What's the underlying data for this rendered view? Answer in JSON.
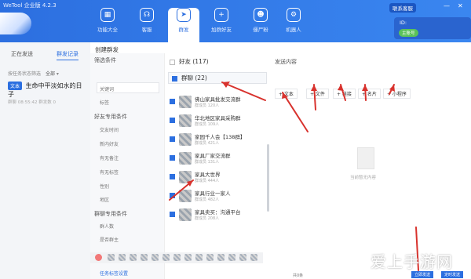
{
  "app": {
    "name": "WeTool 企业版 4.2.3"
  },
  "nav": [
    {
      "label": "功能大全",
      "icon": "grid-icon",
      "active": false
    },
    {
      "label": "客服",
      "icon": "headset-icon",
      "active": false
    },
    {
      "label": "群发",
      "icon": "send-icon",
      "active": true
    },
    {
      "label": "加群好友",
      "icon": "add-friend-icon",
      "active": false
    },
    {
      "label": "僵尸粉",
      "icon": "zombie-icon",
      "active": false
    },
    {
      "label": "机器人",
      "icon": "robot-icon",
      "active": false
    }
  ],
  "header": {
    "contact_btn": "联系客服",
    "user_id": "ID:",
    "online": "主账号"
  },
  "left": {
    "tab_sending": "正在发送",
    "tab_records": "群发记录",
    "filter_label": "按任务状态筛选",
    "filter_value": "全部",
    "task_tag": "文本",
    "task_title": "生命中平淡如水的日子",
    "task_meta": "群聊 08:55:42  群发数 0"
  },
  "modal": {
    "title": "创建群发",
    "filter_header": "筛选条件",
    "keyword_label": "关键词",
    "tag_label": "标签",
    "friend_section": "好友专用条件",
    "friend_items": [
      "交友时间",
      "新内好友",
      "有无备注",
      "有无标签",
      "性别",
      "地区"
    ],
    "group_section": "群聊专用条件",
    "group_items": [
      "群人数",
      "是否群主"
    ],
    "friends_header": "好友 (117)",
    "groups_header": "群聊 (22)",
    "groups": [
      {
        "name": "佛山家具批发交流群",
        "sub": "群成员 120人",
        "checked": true
      },
      {
        "name": "华北地区家具采购群",
        "sub": "群成员 109人",
        "checked": true
      },
      {
        "name": "家园千人会【138群】",
        "sub": "群成员 421人",
        "checked": true
      },
      {
        "name": "家具厂家交流群",
        "sub": "群成员 131人",
        "checked": true
      },
      {
        "name": "家具大世界",
        "sub": "群成员 444人",
        "checked": true
      },
      {
        "name": "家具行业一家人",
        "sub": "群成员 482人",
        "checked": true
      },
      {
        "name": "家具卖买：沟通平台",
        "sub": "群成员 208人",
        "checked": true
      }
    ],
    "task_settings_link": "任务标签设置",
    "content_header": "发送内容",
    "add_buttons": [
      "+ 文本",
      "+ 文件",
      "+ 链接",
      "+ 名片",
      "+ 小程序"
    ],
    "empty_text": "当前暂无内容",
    "footer_text": "共0条",
    "footer_btns": [
      "立即发送",
      "定时发送"
    ]
  },
  "watermark": "爱上手游网"
}
